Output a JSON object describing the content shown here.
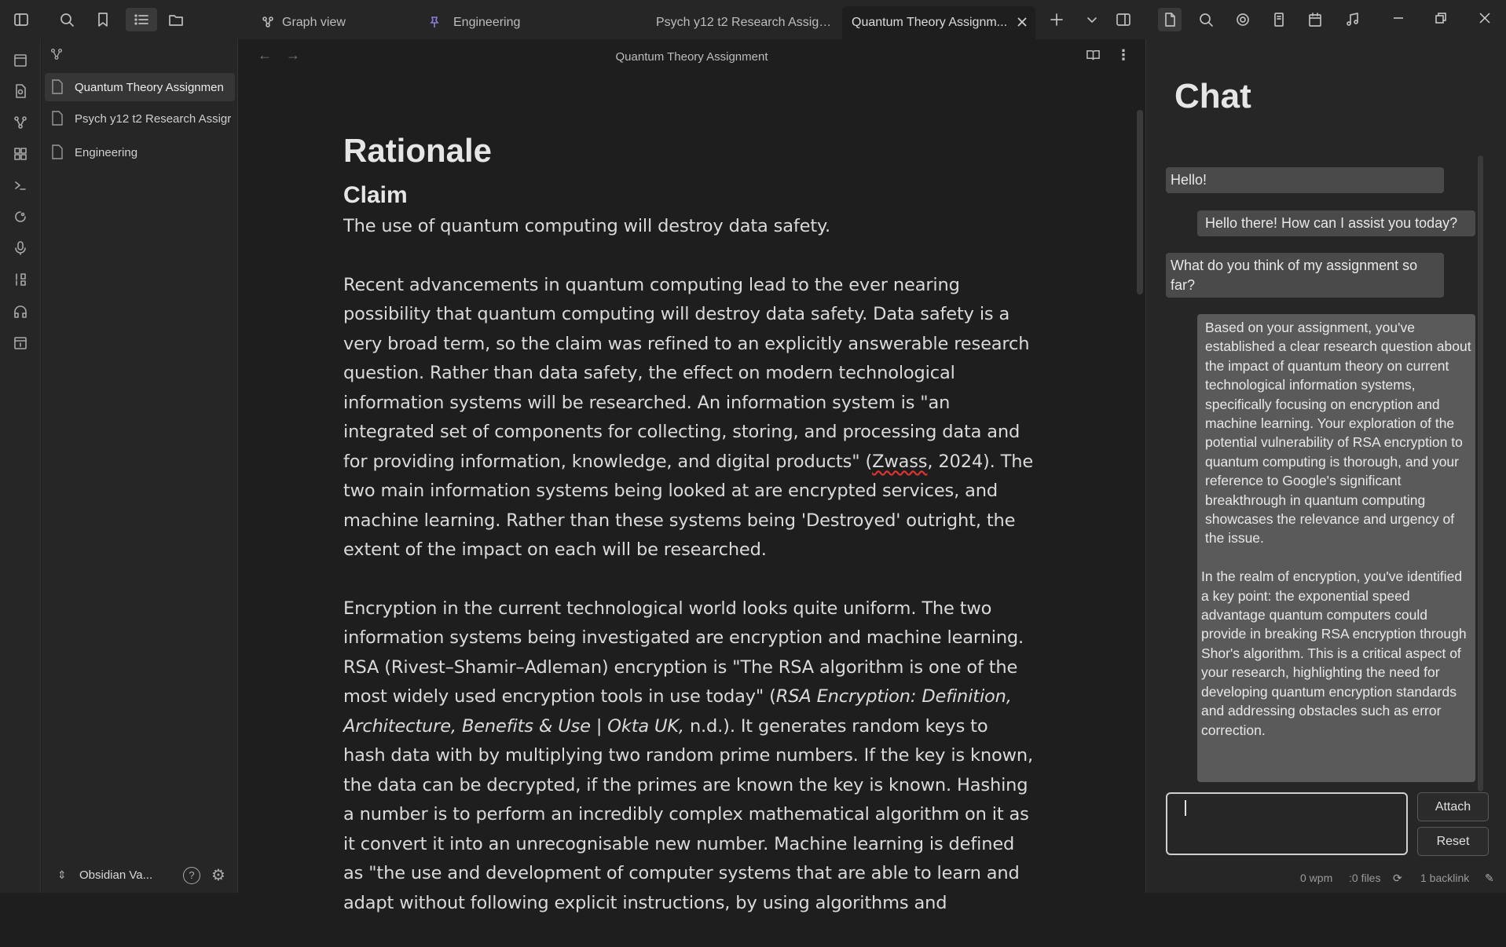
{
  "tabs": [
    {
      "label": "Graph view",
      "icon": "graph-icon"
    },
    {
      "label": "Engineering",
      "icon": "pin-icon"
    },
    {
      "label": "Psych y12 t2 Research Assign...",
      "icon": ""
    },
    {
      "label": "Quantum Theory Assignm...",
      "icon": "",
      "active": true
    }
  ],
  "sidebar": {
    "files": [
      "Quantum Theory Assignmen",
      "Psych y12 t2 Research Assigr",
      "Engineering"
    ],
    "vault_name": "Obsidian Va..."
  },
  "view": {
    "title": "Quantum Theory Assignment"
  },
  "doc": {
    "h1": "Rationale",
    "h2": "Claim",
    "claim": "The use of quantum computing will destroy data safety.",
    "p1_a": "Recent advancements in quantum computing lead to the ever nearing possibility that quantum computing will destroy data safety. Data safety is a very broad term, so the claim was refined to an explicitly answerable research question. Rather than data safety, the effect on modern technological information systems will be researched. An information system is \"an integrated set of components for collecting, storing, and processing data and for providing information, knowledge, and digital products\" (",
    "p1_cite": "Zwass",
    "p1_b": ", 2024). The two main information systems being looked at are encrypted services, and machine learning. Rather than these systems being 'Destroyed' outright, the extent of the impact on each will be researched.",
    "p2_a": "Encryption in the current technological world looks quite uniform. The two information systems being investigated are encryption and machine learning. RSA (Rivest–Shamir–Adleman) encryption is \"The RSA algorithm is one of the most widely used encryption tools in use today\" (",
    "p2_italic": "RSA Encryption: Definition, Architecture, Benefits & Use | Okta UK,",
    "p2_b": " n.d.). It generates random keys to hash data with by multiplying two random prime numbers. If the key is known, the data can be decrypted, if the primes are known the key is known. Hashing a number is to perform an incredibly complex mathematical algorithm on it as it convert it into an unrecognisable new number. Machine learning is defined as \"the use and development of computer systems that are able to learn and adapt without following explicit instructions, by using algorithms and"
  },
  "chat": {
    "title": "Chat",
    "m1": "Hello!",
    "m2": "Hello there! How can I assist you today?",
    "m3": "What do you think of my assignment so far?",
    "m4a": "Based on your assignment, you've established a clear research question about the impact of quantum theory on current technological information systems, specifically focusing on encryption and machine learning. Your exploration of the potential vulnerability of RSA encryption to quantum computing is thorough, and your reference to Google's significant breakthrough in quantum computing showcases the relevance and urgency of the issue.",
    "m4b": "In the realm of encryption, you've identified a key point: the exponential speed advantage quantum computers could provide in breaking RSA encryption through Shor's algorithm. This is a critical aspect of your research, highlighting the need for developing quantum encryption standards and addressing obstacles such as error correction.",
    "attach": "Attach",
    "reset": "Reset"
  },
  "status": {
    "wpm": "0 wpm",
    "files": ":0 files",
    "backlinks": "1 backlink"
  }
}
